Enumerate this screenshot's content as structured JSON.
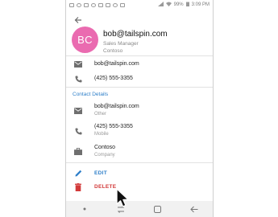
{
  "status": {
    "time": "3:09 PM",
    "battery": "99%",
    "left_icons": [
      "notification-icon",
      "notification-icon",
      "notification-icon",
      "notification-icon",
      "notification-icon",
      "notification-icon",
      "notification-icon",
      "notification-icon"
    ],
    "right_icons": [
      "signal-icon",
      "wifi-icon",
      "battery-icon"
    ]
  },
  "contact": {
    "initials": "BC",
    "name": "bob@tailspin.com",
    "title": "Sales Manager",
    "company": "Contoso",
    "avatar_color": "#ea6bb0"
  },
  "quick_rows": [
    {
      "icon": "email-icon",
      "value": "bob@tailspin.com"
    },
    {
      "icon": "phone-icon",
      "value": "(425) 555-3355"
    }
  ],
  "details": {
    "section_title": "Contact Details",
    "rows": [
      {
        "icon": "email-icon",
        "value": "bob@tailspin.com",
        "label": "Other"
      },
      {
        "icon": "phone-icon",
        "value": "(425) 555-3355",
        "label": "Mobile"
      },
      {
        "icon": "briefcase-icon",
        "value": "Contoso",
        "label": "Company"
      }
    ]
  },
  "actions": {
    "edit": "EDIT",
    "delete": "DELETE"
  },
  "colors": {
    "accent": "#2e7fc9",
    "danger": "#d23a3a"
  }
}
